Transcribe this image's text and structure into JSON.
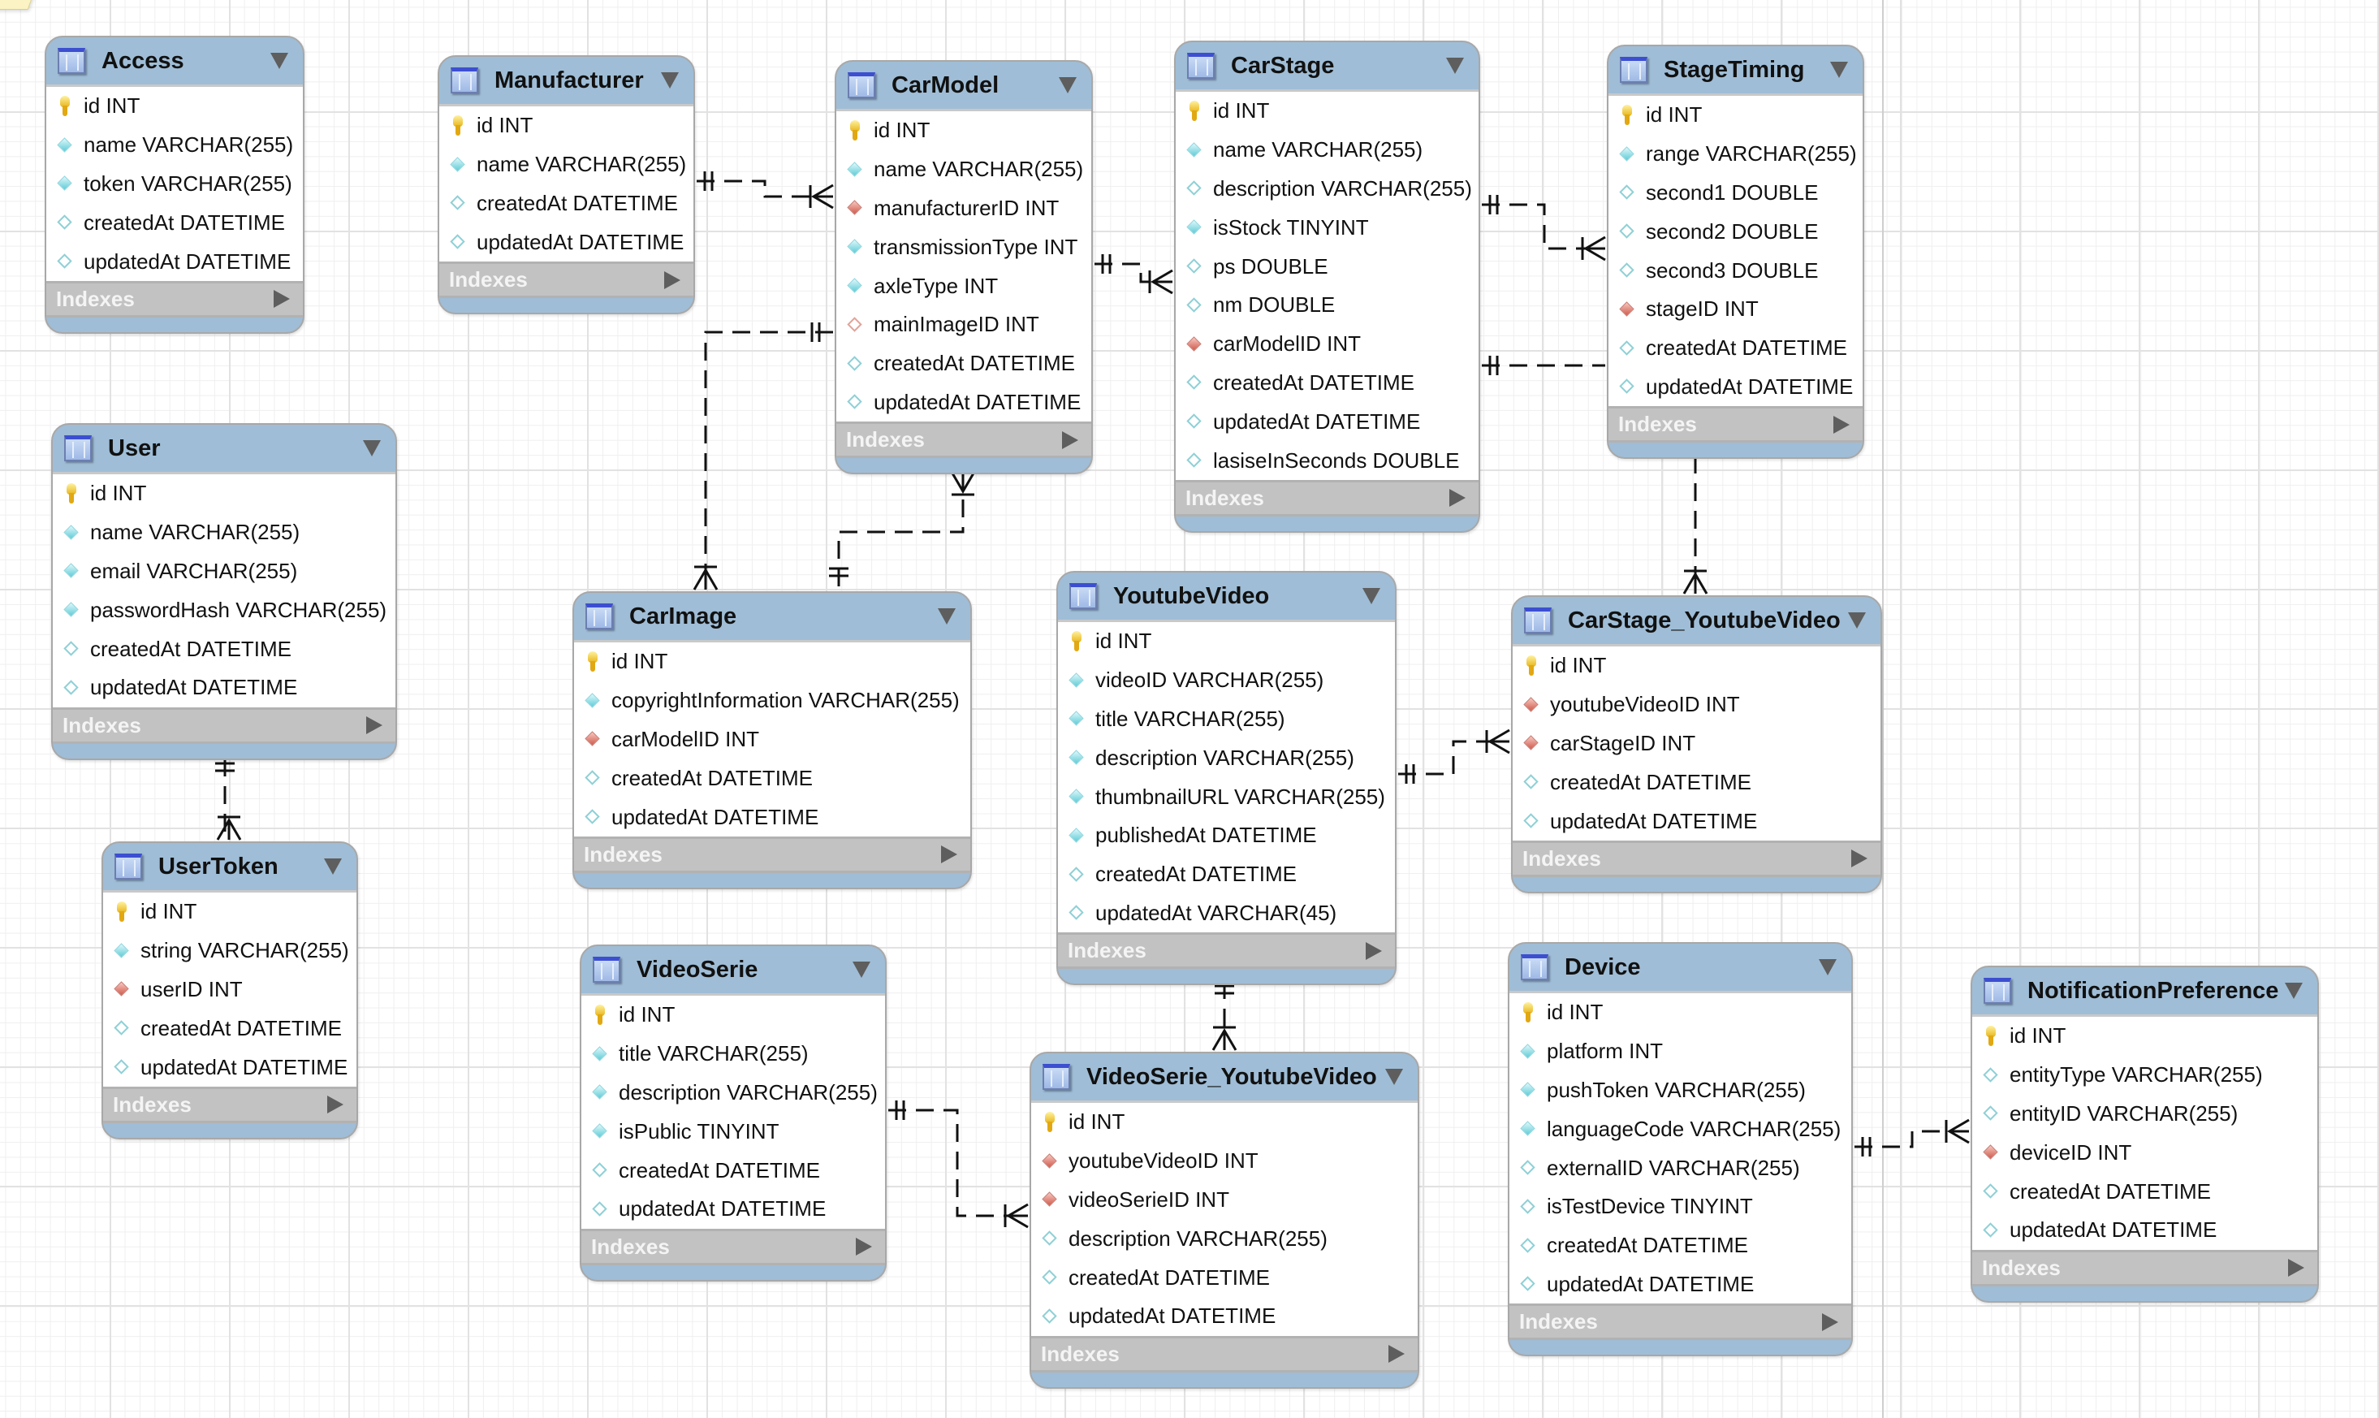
{
  "diagram": {
    "indexes_label": "Indexes",
    "tables": [
      {
        "id": "access",
        "name": "Access",
        "columns": [
          {
            "text": "id INT",
            "key": "pk"
          },
          {
            "text": "name VARCHAR(255)",
            "key": "nn"
          },
          {
            "text": "token VARCHAR(255)",
            "key": "nn"
          },
          {
            "text": "createdAt DATETIME",
            "key": "opt"
          },
          {
            "text": "updatedAt DATETIME",
            "key": "opt"
          }
        ]
      },
      {
        "id": "manufacturer",
        "name": "Manufacturer",
        "columns": [
          {
            "text": "id INT",
            "key": "pk"
          },
          {
            "text": "name VARCHAR(255)",
            "key": "nn"
          },
          {
            "text": "createdAt DATETIME",
            "key": "opt"
          },
          {
            "text": "updatedAt DATETIME",
            "key": "opt"
          }
        ]
      },
      {
        "id": "carmodel",
        "name": "CarModel",
        "columns": [
          {
            "text": "id INT",
            "key": "pk"
          },
          {
            "text": "name VARCHAR(255)",
            "key": "nn"
          },
          {
            "text": "manufacturerID INT",
            "key": "fk"
          },
          {
            "text": "transmissionType INT",
            "key": "nn"
          },
          {
            "text": "axleType INT",
            "key": "nn"
          },
          {
            "text": "mainImageID INT",
            "key": "fko"
          },
          {
            "text": "createdAt DATETIME",
            "key": "opt"
          },
          {
            "text": "updatedAt DATETIME",
            "key": "opt"
          }
        ]
      },
      {
        "id": "carstage",
        "name": "CarStage",
        "columns": [
          {
            "text": "id INT",
            "key": "pk"
          },
          {
            "text": "name VARCHAR(255)",
            "key": "nn"
          },
          {
            "text": "description VARCHAR(255)",
            "key": "opt"
          },
          {
            "text": "isStock TINYINT",
            "key": "nn"
          },
          {
            "text": "ps DOUBLE",
            "key": "opt"
          },
          {
            "text": "nm DOUBLE",
            "key": "opt"
          },
          {
            "text": "carModelID INT",
            "key": "fk"
          },
          {
            "text": "createdAt DATETIME",
            "key": "opt"
          },
          {
            "text": "updatedAt DATETIME",
            "key": "opt"
          },
          {
            "text": "lasiseInSeconds DOUBLE",
            "key": "opt"
          }
        ]
      },
      {
        "id": "stagetiming",
        "name": "StageTiming",
        "columns": [
          {
            "text": "id INT",
            "key": "pk"
          },
          {
            "text": "range VARCHAR(255)",
            "key": "nn"
          },
          {
            "text": "second1 DOUBLE",
            "key": "opt"
          },
          {
            "text": "second2 DOUBLE",
            "key": "opt"
          },
          {
            "text": "second3 DOUBLE",
            "key": "opt"
          },
          {
            "text": "stageID INT",
            "key": "fk"
          },
          {
            "text": "createdAt DATETIME",
            "key": "opt"
          },
          {
            "text": "updatedAt DATETIME",
            "key": "opt"
          }
        ]
      },
      {
        "id": "user",
        "name": "User",
        "columns": [
          {
            "text": "id INT",
            "key": "pk"
          },
          {
            "text": "name VARCHAR(255)",
            "key": "nn"
          },
          {
            "text": "email VARCHAR(255)",
            "key": "nn"
          },
          {
            "text": "passwordHash VARCHAR(255)",
            "key": "nn"
          },
          {
            "text": "createdAt DATETIME",
            "key": "opt"
          },
          {
            "text": "updatedAt DATETIME",
            "key": "opt"
          }
        ]
      },
      {
        "id": "usertoken",
        "name": "UserToken",
        "columns": [
          {
            "text": "id INT",
            "key": "pk"
          },
          {
            "text": "string VARCHAR(255)",
            "key": "nn"
          },
          {
            "text": "userID INT",
            "key": "fk"
          },
          {
            "text": "createdAt DATETIME",
            "key": "opt"
          },
          {
            "text": "updatedAt DATETIME",
            "key": "opt"
          }
        ]
      },
      {
        "id": "carimage",
        "name": "CarImage",
        "columns": [
          {
            "text": "id INT",
            "key": "pk"
          },
          {
            "text": "copyrightInformation VARCHAR(255)",
            "key": "nn"
          },
          {
            "text": "carModelID INT",
            "key": "fk"
          },
          {
            "text": "createdAt DATETIME",
            "key": "opt"
          },
          {
            "text": "updatedAt DATETIME",
            "key": "opt"
          }
        ]
      },
      {
        "id": "youtubevideo",
        "name": "YoutubeVideo",
        "columns": [
          {
            "text": "id INT",
            "key": "pk"
          },
          {
            "text": "videoID VARCHAR(255)",
            "key": "nn"
          },
          {
            "text": "title VARCHAR(255)",
            "key": "nn"
          },
          {
            "text": "description VARCHAR(255)",
            "key": "nn"
          },
          {
            "text": "thumbnailURL VARCHAR(255)",
            "key": "nn"
          },
          {
            "text": "publishedAt DATETIME",
            "key": "nn"
          },
          {
            "text": "createdAt DATETIME",
            "key": "opt"
          },
          {
            "text": "updatedAt VARCHAR(45)",
            "key": "opt"
          }
        ]
      },
      {
        "id": "carstage_youtubevideo",
        "name": "CarStage_YoutubeVideo",
        "columns": [
          {
            "text": "id INT",
            "key": "pk"
          },
          {
            "text": "youtubeVideoID INT",
            "key": "fk"
          },
          {
            "text": "carStageID INT",
            "key": "fk"
          },
          {
            "text": "createdAt DATETIME",
            "key": "opt"
          },
          {
            "text": "updatedAt DATETIME",
            "key": "opt"
          }
        ]
      },
      {
        "id": "videoserie",
        "name": "VideoSerie",
        "columns": [
          {
            "text": "id INT",
            "key": "pk"
          },
          {
            "text": "title VARCHAR(255)",
            "key": "nn"
          },
          {
            "text": "description VARCHAR(255)",
            "key": "nn"
          },
          {
            "text": "isPublic TINYINT",
            "key": "nn"
          },
          {
            "text": "createdAt DATETIME",
            "key": "opt"
          },
          {
            "text": "updatedAt DATETIME",
            "key": "opt"
          }
        ]
      },
      {
        "id": "videoserie_youtubevideo",
        "name": "VideoSerie_YoutubeVideo",
        "columns": [
          {
            "text": "id INT",
            "key": "pk"
          },
          {
            "text": "youtubeVideoID INT",
            "key": "fk"
          },
          {
            "text": "videoSerieID INT",
            "key": "fk"
          },
          {
            "text": "description VARCHAR(255)",
            "key": "opt"
          },
          {
            "text": "createdAt DATETIME",
            "key": "opt"
          },
          {
            "text": "updatedAt DATETIME",
            "key": "opt"
          }
        ]
      },
      {
        "id": "device",
        "name": "Device",
        "columns": [
          {
            "text": "id INT",
            "key": "pk"
          },
          {
            "text": "platform INT",
            "key": "nn"
          },
          {
            "text": "pushToken VARCHAR(255)",
            "key": "nn"
          },
          {
            "text": "languageCode VARCHAR(255)",
            "key": "nn"
          },
          {
            "text": "externalID VARCHAR(255)",
            "key": "opt"
          },
          {
            "text": "isTestDevice TINYINT",
            "key": "opt"
          },
          {
            "text": "createdAt DATETIME",
            "key": "opt"
          },
          {
            "text": "updatedAt DATETIME",
            "key": "opt"
          }
        ]
      },
      {
        "id": "notificationpreference",
        "name": "NotificationPreference",
        "columns": [
          {
            "text": "id INT",
            "key": "pk"
          },
          {
            "text": "entityType VARCHAR(255)",
            "key": "opt"
          },
          {
            "text": "entityID VARCHAR(255)",
            "key": "opt"
          },
          {
            "text": "deviceID INT",
            "key": "fk"
          },
          {
            "text": "createdAt DATETIME",
            "key": "opt"
          },
          {
            "text": "updatedAt DATETIME",
            "key": "opt"
          }
        ]
      }
    ],
    "relationships": [
      {
        "from": "manufacturer",
        "to": "carmodel",
        "cardinality": "one-to-many"
      },
      {
        "from": "carmodel",
        "to": "carstage",
        "cardinality": "one-to-many"
      },
      {
        "from": "carmodel",
        "to": "carimage",
        "cardinality": "one-to-many"
      },
      {
        "from": "carimage",
        "to": "carmodel",
        "cardinality": "one-to-many"
      },
      {
        "from": "carstage",
        "to": "stagetiming",
        "cardinality": "one-to-many"
      },
      {
        "from": "carstage",
        "to": "carstage_youtubevideo",
        "cardinality": "one-to-many"
      },
      {
        "from": "user",
        "to": "usertoken",
        "cardinality": "one-to-many"
      },
      {
        "from": "youtubevideo",
        "to": "carstage_youtubevideo",
        "cardinality": "one-to-many"
      },
      {
        "from": "youtubevideo",
        "to": "videoserie_youtubevideo",
        "cardinality": "one-to-many"
      },
      {
        "from": "videoserie",
        "to": "videoserie_youtubevideo",
        "cardinality": "one-to-many"
      },
      {
        "from": "device",
        "to": "notificationpreference",
        "cardinality": "one-to-many"
      }
    ]
  }
}
